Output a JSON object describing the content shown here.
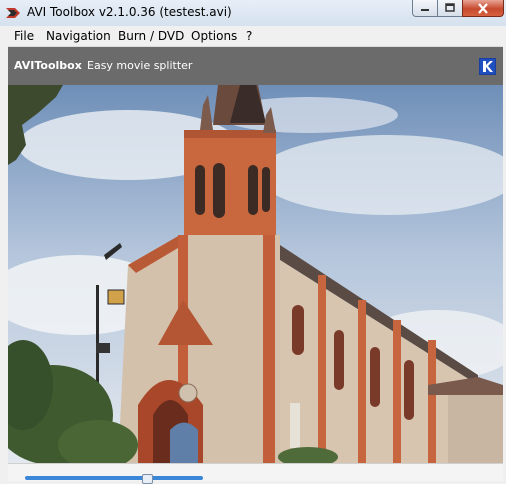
{
  "window": {
    "title": "AVI Toolbox v2.1.0.36 (testest.avi)",
    "icon": "avi-toolbox-app-icon",
    "controls": [
      "minimize-icon",
      "maximize-icon",
      "close-icon"
    ]
  },
  "menu": {
    "items": [
      {
        "label": "File"
      },
      {
        "label": "Navigation"
      },
      {
        "label": "Burn / DVD"
      },
      {
        "label": "Options"
      },
      {
        "label": "?"
      }
    ]
  },
  "header": {
    "app_name": "AVIToolbox",
    "subtitle": "Easy movie splitter",
    "logo": "avitoolbox-logo-icon"
  },
  "video": {
    "content": "church-frame"
  },
  "position_slider": {
    "progress_fraction": 0.27
  },
  "colors": {
    "header_bg": "#6b6b6b",
    "slider_fill": "#3a86d9",
    "close_button": "#c74a2f"
  }
}
